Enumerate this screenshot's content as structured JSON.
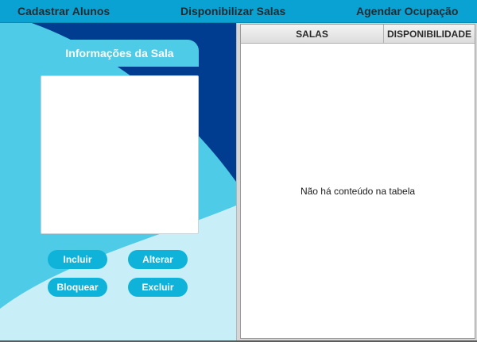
{
  "menu": {
    "items": [
      {
        "label": "Cadastrar Alunos"
      },
      {
        "label": "Disponibilizar Salas"
      },
      {
        "label": "Agendar Ocupação"
      }
    ]
  },
  "form": {
    "title": "Informações da Sala",
    "description_value": "",
    "buttons": {
      "incluir": "Incluir",
      "alterar": "Alterar",
      "bloquear": "Bloquear",
      "excluir": "Excluir"
    }
  },
  "table": {
    "columns": [
      "SALAS",
      "DISPONIBILIDADE"
    ],
    "rows": [],
    "empty_message": "Não há conteúdo na tabela"
  },
  "colors": {
    "menubar": "#0aa2d3",
    "dark_blue": "#003c8f",
    "mid_blue": "#4ecbe6",
    "light_blue": "#c8eff8",
    "button": "#0fb3d9"
  }
}
